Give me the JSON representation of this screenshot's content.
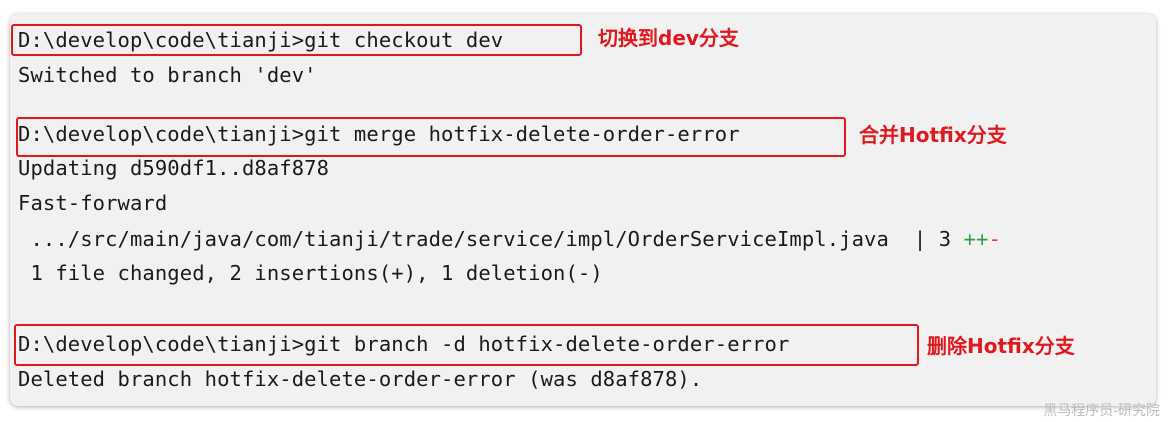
{
  "terminal": {
    "lines": [
      "D:\\develop\\code\\tianji>git checkout dev",
      "Switched to branch 'dev'",
      "D:\\develop\\code\\tianji>git merge hotfix-delete-order-error",
      "Updating d590df1..d8af878",
      "Fast-forward",
      " .../src/main/java/com/tianji/trade/service/impl/OrderServiceImpl.java  | 3 ",
      " 1 file changed, 2 insertions(+), 1 deletion(-)",
      "D:\\develop\\code\\tianji>git branch -d hotfix-delete-order-error",
      "Deleted branch hotfix-delete-order-error (was d8af878)."
    ],
    "diffstat_plus": "++",
    "diffstat_minus": "-"
  },
  "annotations": {
    "checkout": "切换到dev分支",
    "merge": "合并Hotfix分支",
    "delete": "删除Hotfix分支"
  },
  "watermark": "黑马程序员-研究院",
  "colors": {
    "annotation": "#e0191f",
    "diff_plus": "#2ea043",
    "diff_minus": "#d73a49",
    "panel_bg": "#f1f1f1"
  }
}
